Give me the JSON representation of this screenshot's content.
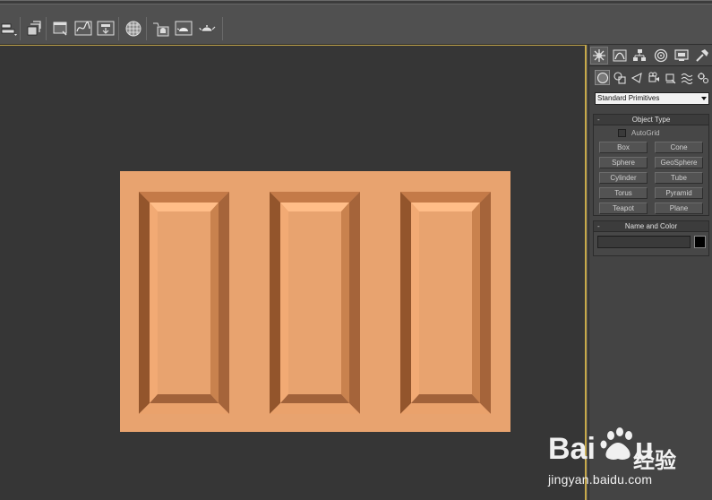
{
  "toolbar": {
    "buttons": [
      {
        "name": "align-icon",
        "label": ""
      },
      {
        "name": "layer-manager-icon",
        "label": ""
      },
      {
        "name": "scene-explorer-icon",
        "label": ""
      },
      {
        "name": "curve-editor-icon",
        "label": ""
      },
      {
        "name": "schematic-view-icon",
        "label": ""
      },
      {
        "name": "material-editor-icon",
        "label": ""
      },
      {
        "name": "render-setup-icon",
        "label": ""
      },
      {
        "name": "rendered-frame-window-icon",
        "label": ""
      },
      {
        "name": "render-teapot-icon",
        "label": ""
      }
    ]
  },
  "viewport": {
    "background_color": "#363636",
    "object_color": "#e8a36f"
  },
  "command_panel": {
    "tabs": [
      "create-tab",
      "modify-tab",
      "hierarchy-tab",
      "motion-tab",
      "display-tab",
      "utilities-tab"
    ],
    "subcategories": [
      "geometry",
      "shapes",
      "lights",
      "cameras",
      "helpers",
      "space-warps",
      "systems"
    ],
    "category_value": "Standard Primitives",
    "object_type": {
      "title": "Object Type",
      "autogrid_label": "AutoGrid",
      "autogrid_checked": false,
      "buttons": [
        "Box",
        "Cone",
        "Sphere",
        "GeoSphere",
        "Cylinder",
        "Tube",
        "Torus",
        "Pyramid",
        "Teapot",
        "Plane"
      ]
    },
    "name_color": {
      "title": "Name and Color",
      "name_value": "",
      "swatch_color": "#000000"
    },
    "rollout_collapse_symbol": "-"
  },
  "watermark": {
    "brand": "Baidu",
    "suffix": "经验",
    "url": "jingyan.baidu.com"
  }
}
